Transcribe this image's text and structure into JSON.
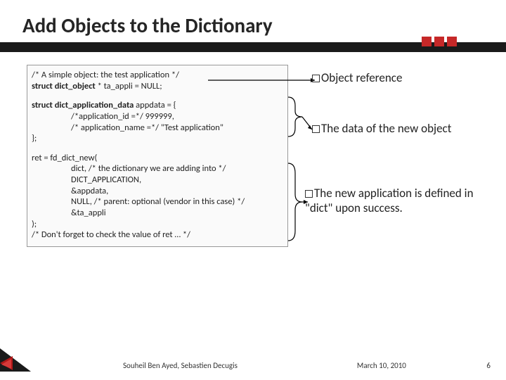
{
  "title": "Add Objects to the Dictionary",
  "code": {
    "block1": {
      "l1": "/* A simple object: the test application */",
      "l2a": "struct dict_object",
      "l2b": " * ta_appli = NULL;"
    },
    "block2": {
      "l1a": "struct dict_application_data",
      "l1b": "  appdata = {",
      "l2": "/*application_id =*/ 999999,",
      "l3": "/* application_name =*/ \"Test application\"",
      "l4": "};"
    },
    "block3": {
      "l1": "ret = fd_dict_new(",
      "l2": "dict,  /* the dictionary we are adding into */",
      "l3": "DICT_APPLICATION,",
      "l4": "&appdata,",
      "l5": "NULL, /* parent: optional (vendor in this case) */",
      "l6": "&ta_appli",
      "l7": ");",
      "l8": "/* Don't forget to check the value of ret … */"
    }
  },
  "callouts": {
    "c1": "Object reference",
    "c2": "The data of the new object",
    "c3": "The new application is defined in \"dict\" upon success."
  },
  "footer": {
    "author": "Souheil Ben Ayed, Sebastien Decugis",
    "date": "March 10, 2010",
    "pagenum": "6"
  }
}
